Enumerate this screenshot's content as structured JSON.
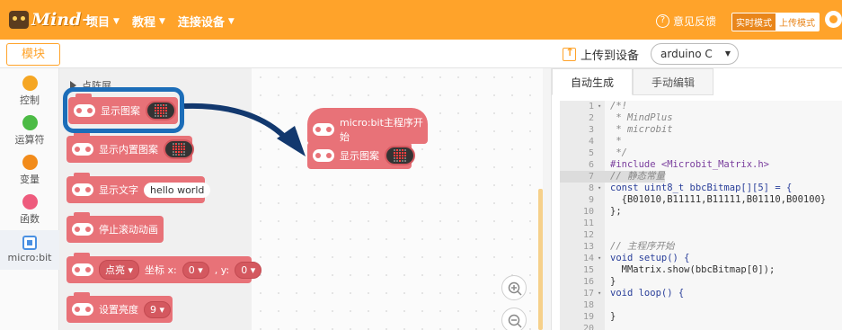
{
  "app": {
    "logo_text": "Mind+"
  },
  "menu": [
    {
      "label": "项目"
    },
    {
      "label": "教程"
    },
    {
      "label": "连接设备"
    }
  ],
  "header_right": {
    "feedback": "意见反馈",
    "mode_live": "实时模式",
    "mode_upload": "上传模式"
  },
  "left_header": {
    "modules_button": "模块"
  },
  "categories": [
    {
      "label": "控制",
      "color": "#f5a623"
    },
    {
      "label": "运算符",
      "color": "#4cbb45"
    },
    {
      "label": "变量",
      "color": "#f28b1a"
    },
    {
      "label": "函数",
      "color": "#ee5b7d"
    },
    {
      "label": "micro:bit",
      "icon": "microbit-chip-icon"
    }
  ],
  "flyout": {
    "section_title": "点阵屏",
    "blocks": {
      "show_pattern": "显示图案",
      "show_builtin_pattern": "显示内置图案",
      "show_text": "显示文字",
      "show_text_value": "hello world",
      "stop_scroll": "停止滚动动画",
      "plot_dd": "点亮",
      "coord_x_label": "坐标 x:",
      "x_value": "0",
      "y_label": ", y:",
      "y_value": "0",
      "set_brightness": "设置亮度",
      "brightness_value": "9"
    }
  },
  "workspace": {
    "hat_label": "micro:bit主程序开始",
    "block_label": "显示图案"
  },
  "right_header": {
    "upload_label": "上传到设备",
    "device": "arduino C"
  },
  "code_panel": {
    "tab_auto": "自动生成",
    "tab_manual": "手动编辑",
    "lines": [
      {
        "n": "1",
        "fold": "▾",
        "text": "/*!"
      },
      {
        "n": "2",
        "fold": "",
        "text": " * MindPlus"
      },
      {
        "n": "3",
        "fold": "",
        "text": " * microbit"
      },
      {
        "n": "4",
        "fold": "",
        "text": " *"
      },
      {
        "n": "5",
        "fold": "",
        "text": " */"
      },
      {
        "n": "6",
        "fold": "",
        "text": "#include <Microbit_Matrix.h>"
      },
      {
        "n": "7",
        "fold": "",
        "text": "// 静态常量"
      },
      {
        "n": "8",
        "fold": "▾",
        "text": "const uint8_t bbcBitmap[][5] = {"
      },
      {
        "n": "9",
        "fold": "",
        "text": "  {B01010,B11111,B11111,B01110,B00100}"
      },
      {
        "n": "10",
        "fold": "",
        "text": "};"
      },
      {
        "n": "11",
        "fold": "",
        "text": ""
      },
      {
        "n": "12",
        "fold": "",
        "text": ""
      },
      {
        "n": "13",
        "fold": "",
        "text": "// 主程序开始"
      },
      {
        "n": "14",
        "fold": "▾",
        "text": "void setup() {"
      },
      {
        "n": "15",
        "fold": "",
        "text": "  MMatrix.show(bbcBitmap[0]);"
      },
      {
        "n": "16",
        "fold": "",
        "text": "}"
      },
      {
        "n": "17",
        "fold": "▾",
        "text": "void loop() {"
      },
      {
        "n": "18",
        "fold": "",
        "text": ""
      },
      {
        "n": "19",
        "fold": "",
        "text": "}"
      },
      {
        "n": "20",
        "fold": "",
        "text": ""
      }
    ]
  },
  "heart_pattern": [
    0,
    1,
    0,
    1,
    0,
    1,
    1,
    1,
    1,
    1,
    1,
    1,
    1,
    1,
    1,
    0,
    1,
    1,
    1,
    0,
    0,
    0,
    1,
    0,
    0
  ],
  "colors": {
    "accent": "#ffa32a",
    "block": "#e87278",
    "highlight": "#1c6db8"
  }
}
